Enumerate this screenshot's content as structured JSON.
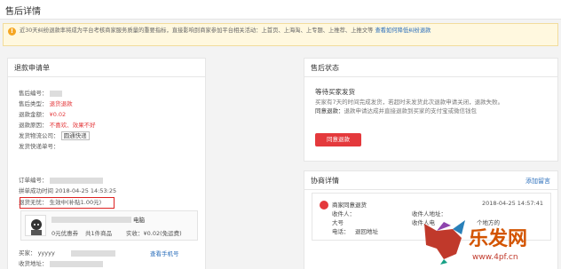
{
  "page": {
    "title": "售后详情"
  },
  "notice": {
    "text": "近30天纠纷退款率将成为平台考核商家服务质量的重要指标，直接影响到商家参加平台相关活动：上首页、上海淘、上专题、上推荐、上推文等",
    "link": "查看如何降低纠纷退款"
  },
  "refund": {
    "header": "退款申请单",
    "labels": {
      "code": "售后编号：",
      "type": "售后类型：",
      "amount": "退款金额：",
      "reason": "退款原因：",
      "logistics": "发货物流公司：",
      "tracking": "发货快递单号：",
      "order_no": "订单编号：",
      "pay_time": "拼单成功时间",
      "insurance": "退货无忧："
    },
    "values": {
      "type": "退货退款",
      "amount": "¥0.02",
      "reason": "不喜欢、效果不好",
      "logistics": "圆通快递",
      "pay_time": "2018-04-25 14:53:25",
      "insurance": "生效中(补贴1.00元)"
    },
    "product": {
      "name_suffix": "电脑",
      "coupon": "0元优惠券",
      "count": "共1件商品",
      "paid": "实收：¥0.02(免运费)"
    },
    "buyer": {
      "label": "买家：",
      "name": "yyyyy",
      "view_phone": "查看手机号"
    },
    "address": {
      "label": "收货地址："
    }
  },
  "status": {
    "header": "售后状态",
    "title": "等待买家发货",
    "text": "买家有7天的时间完成发货，若超时未发货此次退款申请关闭，退款失败。",
    "agree_label": "同意退款：",
    "agree_text": "退款申请达成并直接退款到买家的支付宝或微信钱包",
    "button": "同意退款"
  },
  "negotiation": {
    "header": "协商详情",
    "add_message": "添加留言",
    "item": {
      "title": "商家同意退货",
      "time": "2018-04-25 14:57:41",
      "receiver_label": "收件人：",
      "receiver_mid": "大号",
      "phone_label": "电话：",
      "addr_label": "收件地址：",
      "addr_label2": "退回地址",
      "receiver_label2": "收件人地址：",
      "receiver_label3": "收件人电",
      "region": "个地方的"
    }
  },
  "watermark": {
    "text": "乐发网",
    "url": "www.4pf.cn"
  },
  "colors": {
    "accent": "#e4393c",
    "link": "#2a6ebb",
    "notice_bg": "#fff8df"
  }
}
